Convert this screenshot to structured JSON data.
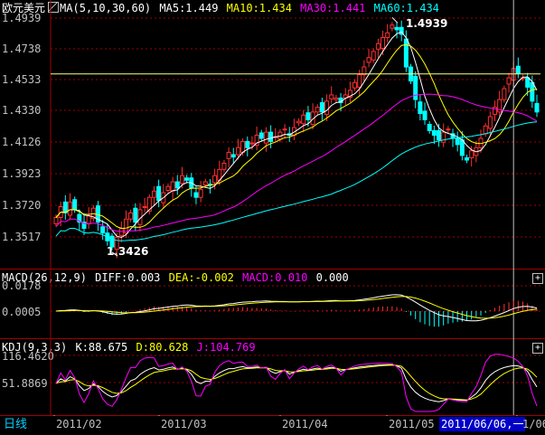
{
  "main": {
    "symbol": "欧元美元",
    "ma_label": "MA(5,10,30,60)",
    "ma5": "MA5:1.449",
    "ma10": "MA10:1.434",
    "ma30": "MA30:1.441",
    "ma60": "MA60:1.434",
    "y_ticks": [
      "1.4939",
      "1.4738",
      "1.4533",
      "1.4330",
      "1.4126",
      "1.3923",
      "1.3720",
      "1.3517"
    ],
    "high_label": "1.4939",
    "low_label": "1.3426"
  },
  "macd": {
    "label": "MACD(26,12,9)",
    "diff": "DIFF:0.003",
    "dea": "DEA:-0.002",
    "macd": "MACD:0.010",
    "extra": "0.000",
    "y_ticks": [
      "0.0178",
      "0.0005"
    ]
  },
  "kdj": {
    "label": "KDJ(9,3,3)",
    "k": "K:88.675",
    "d": "D:80.628",
    "j": "J:104.769",
    "y_ticks": [
      "116.4620",
      "51.8869"
    ]
  },
  "bottom": {
    "period": "日线",
    "dates": [
      "2011/02",
      "2011/03",
      "2011/04",
      "2011/05"
    ],
    "cursor_date": "2011/06/06,一",
    "tail_date": "1/06"
  },
  "colors": {
    "up": "#ff3030",
    "down": "#00ffff",
    "ma5": "#ffffff",
    "ma10": "#ffff00",
    "ma30": "#ff00ff",
    "ma60": "#00ffff",
    "grid": "#a00000"
  },
  "chart_data": {
    "type": "candlestick",
    "title": "欧元美元",
    "y_range": [
      1.335,
      1.497
    ],
    "price_high": 1.4939,
    "price_low": 1.3426,
    "close_series": [
      1.365,
      1.372,
      1.368,
      1.375,
      1.37,
      1.362,
      1.358,
      1.366,
      1.371,
      1.362,
      1.355,
      1.35,
      1.346,
      1.352,
      1.358,
      1.364,
      1.368,
      1.362,
      1.37,
      1.372,
      1.378,
      1.382,
      1.376,
      1.381,
      1.385,
      1.388,
      1.384,
      1.392,
      1.389,
      1.384,
      1.378,
      1.383,
      1.388,
      1.386,
      1.392,
      1.396,
      1.4,
      1.407,
      1.404,
      1.41,
      1.414,
      1.41,
      1.413,
      1.418,
      1.416,
      1.42,
      1.414,
      1.417,
      1.42,
      1.422,
      1.418,
      1.423,
      1.427,
      1.431,
      1.428,
      1.433,
      1.436,
      1.433,
      1.44,
      1.444,
      1.442,
      1.439,
      1.444,
      1.447,
      1.452,
      1.457,
      1.462,
      1.468,
      1.472,
      1.477,
      1.481,
      1.484,
      1.489,
      1.486,
      1.483,
      1.462,
      1.453,
      1.441,
      1.432,
      1.428,
      1.421,
      1.418,
      1.415,
      1.42,
      1.422,
      1.416,
      1.412,
      1.405,
      1.402,
      1.408,
      1.41,
      1.416,
      1.424,
      1.43,
      1.436,
      1.441,
      1.448,
      1.455,
      1.461,
      1.458,
      1.455,
      1.449,
      1.44,
      1.433
    ]
  }
}
